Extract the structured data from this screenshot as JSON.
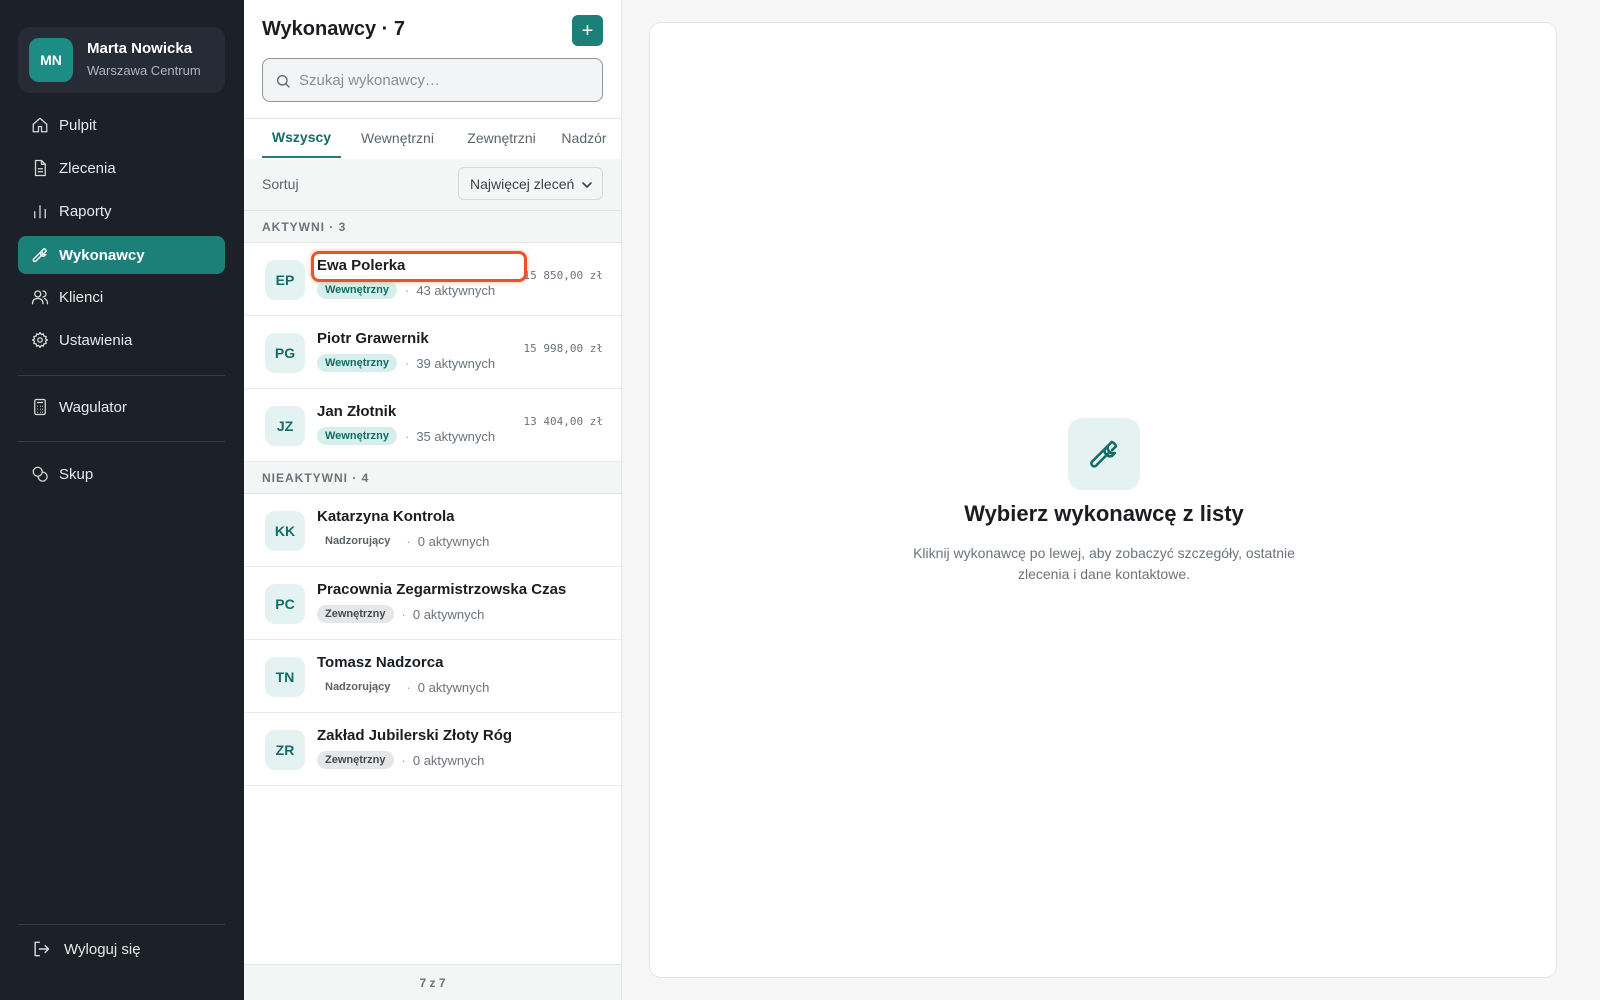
{
  "user": {
    "initials": "MN",
    "name": "Marta Nowicka",
    "branch": "Warszawa Centrum"
  },
  "nav": [
    {
      "label": "Pulpit",
      "icon": "home-icon",
      "active": false
    },
    {
      "label": "Zlecenia",
      "icon": "document-icon",
      "active": false
    },
    {
      "label": "Raporty",
      "icon": "bar-chart-icon",
      "active": false
    },
    {
      "label": "Wykonawcy",
      "icon": "wrench-icon",
      "active": true
    },
    {
      "label": "Klienci",
      "icon": "users-icon",
      "active": false
    },
    {
      "label": "Ustawienia",
      "icon": "gear-icon",
      "active": false
    }
  ],
  "tools": [
    {
      "label": "Wagulator",
      "icon": "calculator-icon"
    },
    {
      "label": "Skup",
      "icon": "coins-icon"
    }
  ],
  "logout": {
    "label": "Wyloguj się",
    "icon": "logout-icon"
  },
  "list": {
    "title": "Wykonawcy · 7",
    "add_label": "+",
    "search_placeholder": "Szukaj wykonawcy…",
    "tabs": [
      "Wszyscy",
      "Wewnętrzni",
      "Zewnętrzni",
      "Nadzór"
    ],
    "active_tab": "Wszyscy",
    "sort_label": "Sortuj",
    "sort_value": "Najwięcej zleceń",
    "groups": [
      {
        "title": "AKTYWNI · 3",
        "rows": [
          {
            "initials": "EP",
            "name": "Ewa Polerka",
            "badge": "Wewnętrzny",
            "count": "43 aktywnych",
            "amount": "15 850,00 zł"
          },
          {
            "initials": "PG",
            "name": "Piotr Grawernik",
            "badge": "Wewnętrzny",
            "count": "39 aktywnych",
            "amount": "15 998,00 zł"
          },
          {
            "initials": "JZ",
            "name": "Jan Złotnik",
            "badge": "Wewnętrzny",
            "count": "35 aktywnych",
            "amount": "13 404,00 zł"
          }
        ]
      },
      {
        "title": "NIEAKTYWNI · 4",
        "rows": [
          {
            "initials": "KK",
            "name": "Katarzyna Kontrola",
            "badge": "Nadzorujący",
            "count": "0 aktywnych",
            "amount": ""
          },
          {
            "initials": "PC",
            "name": "Pracownia Zegarmistrzowska Czas",
            "badge": "Zewnętrzny",
            "count": "0 aktywnych",
            "amount": ""
          },
          {
            "initials": "TN",
            "name": "Tomasz Nadzorca",
            "badge": "Nadzorujący",
            "count": "0 aktywnych",
            "amount": ""
          },
          {
            "initials": "ZR",
            "name": "Zakład Jubilerski Złoty Róg",
            "badge": "Zewnętrzny",
            "count": "0 aktywnych",
            "amount": ""
          }
        ]
      }
    ],
    "footer": "7 z 7"
  },
  "detail": {
    "icon": "wrench-icon",
    "title": "Wybierz wykonawcę z listy",
    "description": "Kliknij wykonawcę po lewej, aby zobaczyć szczegóły, ostatnie zlecenia i dane kontaktowe."
  },
  "colors": {
    "accent": "#1d8078",
    "sidebar_bg": "#1c2129",
    "highlight": "#e8542a"
  }
}
